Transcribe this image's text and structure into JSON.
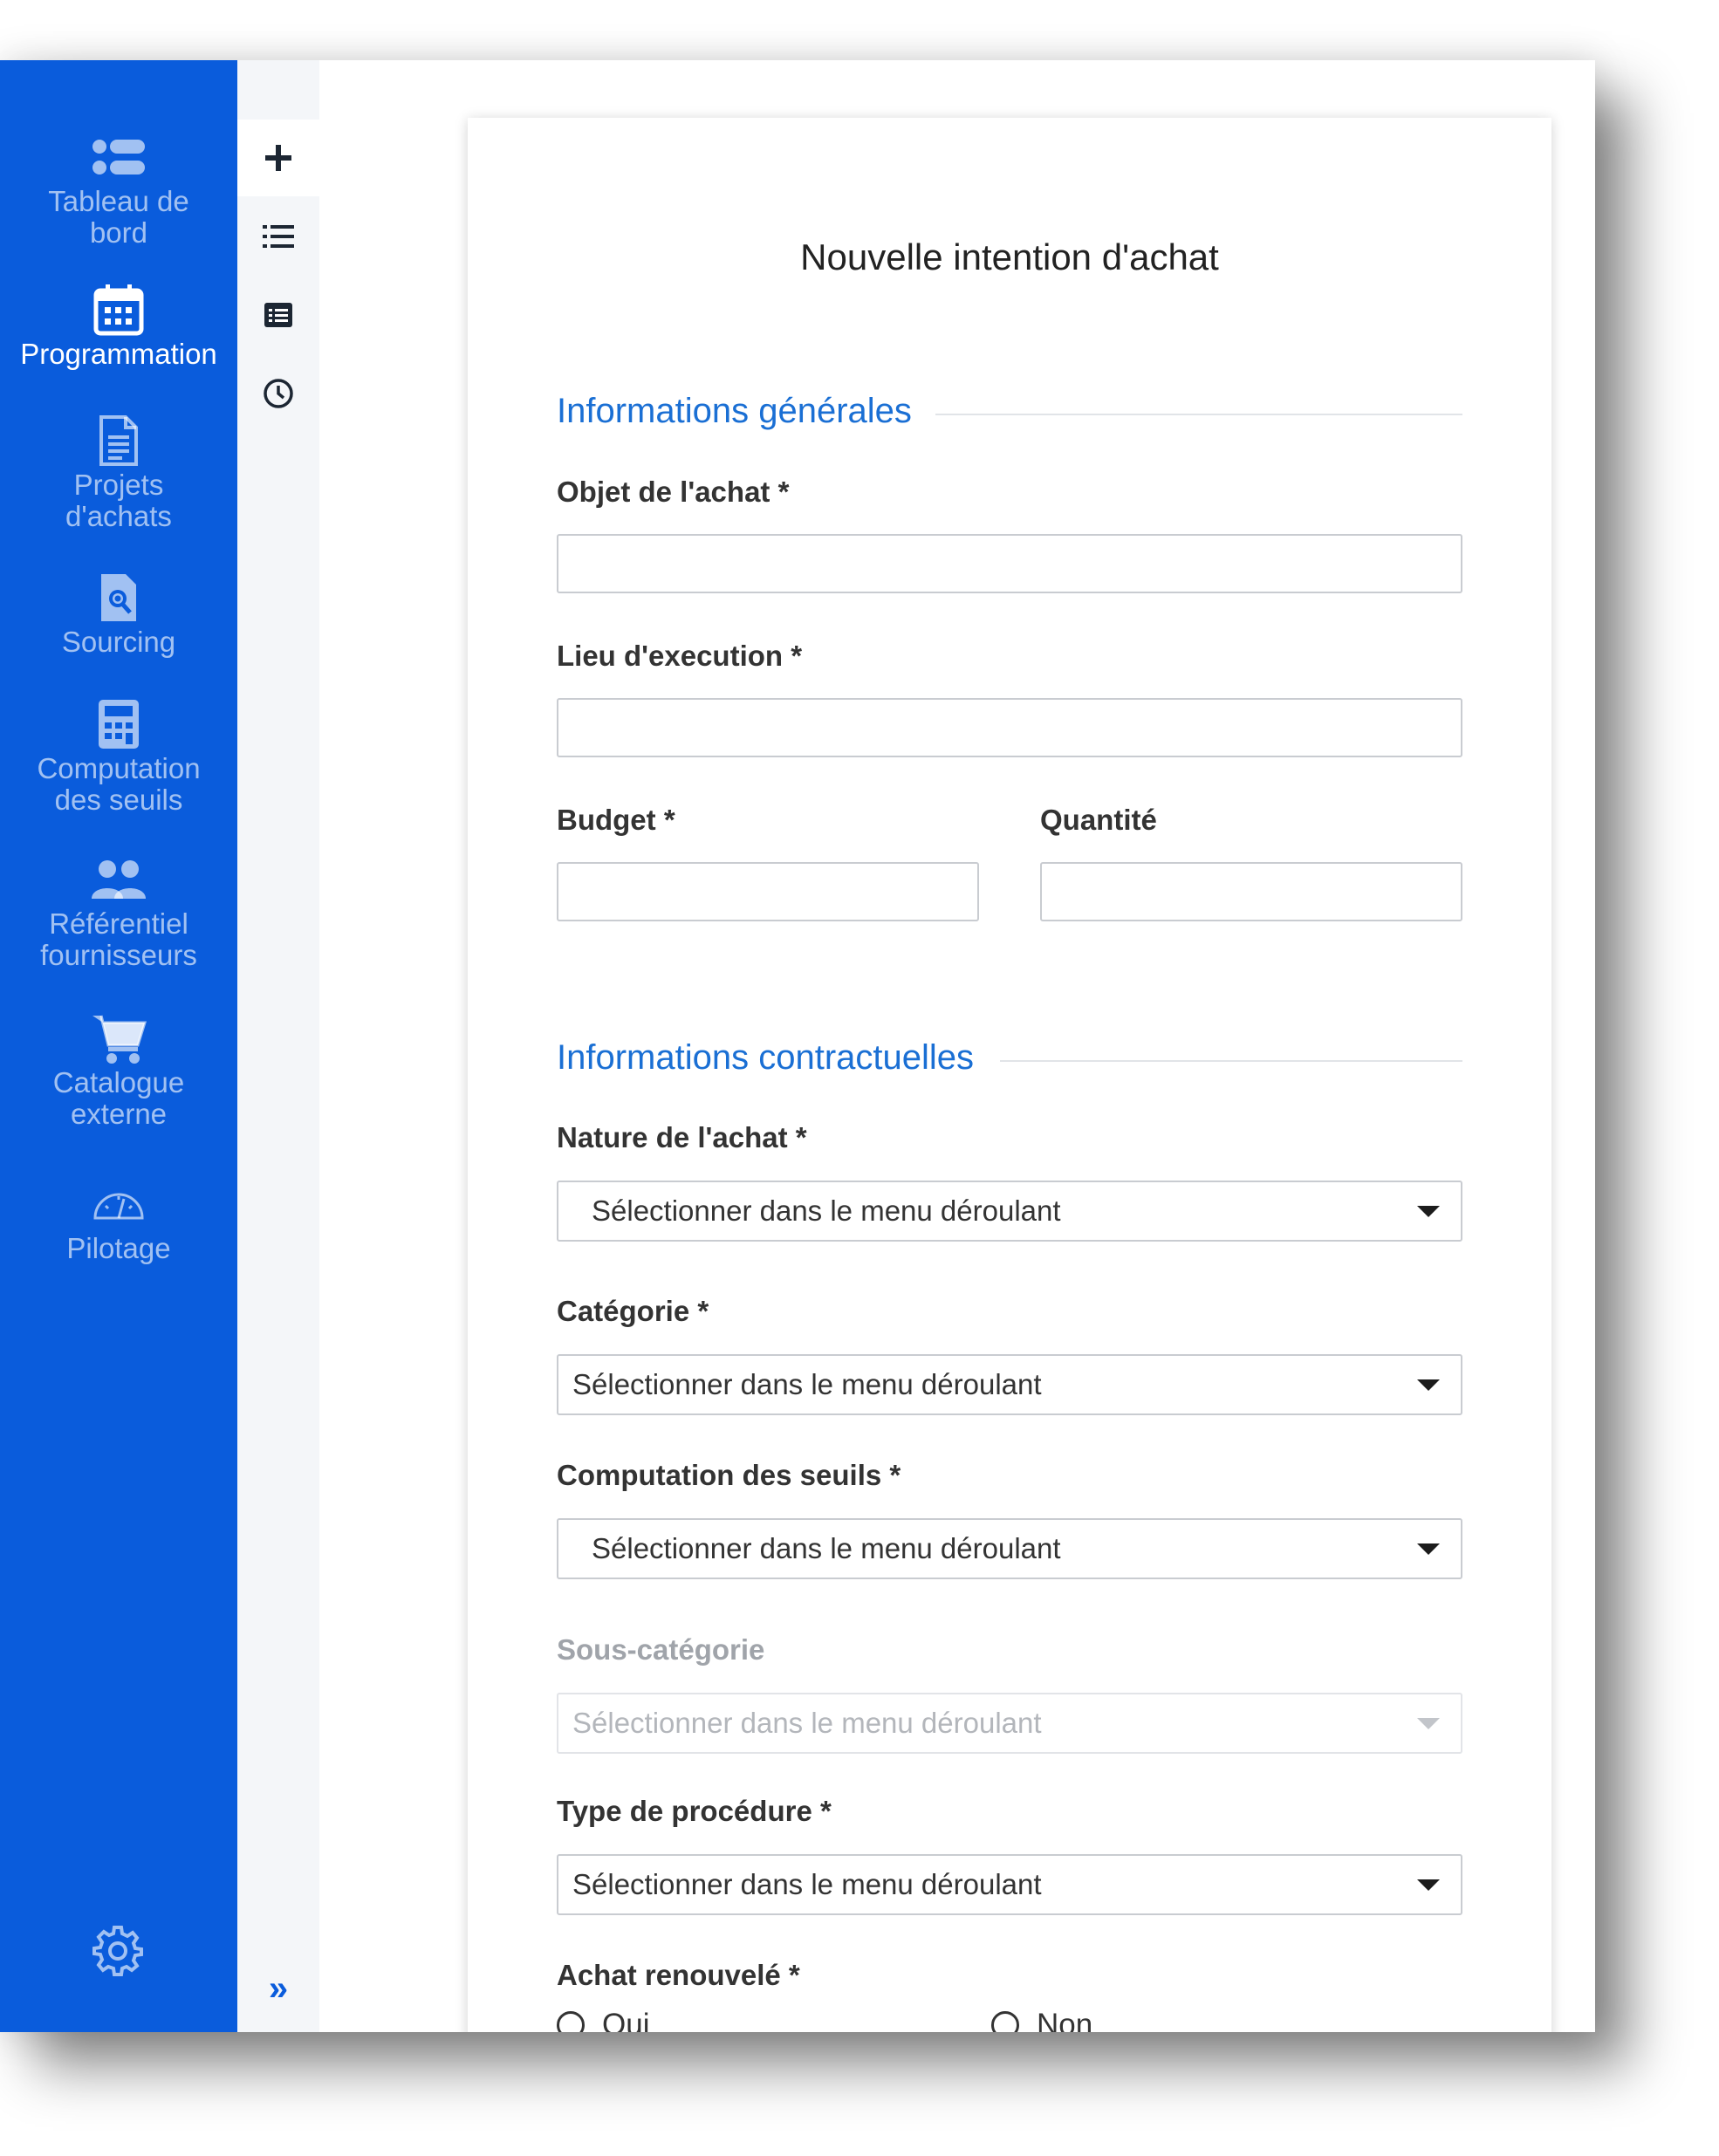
{
  "sidebar": {
    "items": [
      {
        "label": "Tableau de\nbord",
        "icon": "dashboard-icon"
      },
      {
        "label": "Programmation",
        "icon": "calendar-icon"
      },
      {
        "label": "Projets\nd'achats",
        "icon": "document-icon"
      },
      {
        "label": "Sourcing",
        "icon": "document-search-icon"
      },
      {
        "label": "Computation\ndes seuils",
        "icon": "calculator-icon"
      },
      {
        "label": "Référentiel\nfournisseurs",
        "icon": "users-icon"
      },
      {
        "label": "Catalogue\nexterne",
        "icon": "cart-icon"
      },
      {
        "label": "Pilotage",
        "icon": "gauge-icon"
      }
    ],
    "active_item": "Programmation",
    "settings_icon": "gear-icon"
  },
  "subrail": {
    "items": [
      {
        "icon": "plus-icon",
        "active": true
      },
      {
        "icon": "list-icon"
      },
      {
        "icon": "table-list-icon"
      },
      {
        "icon": "clock-icon"
      }
    ],
    "expand_label": "»"
  },
  "form": {
    "title": "Nouvelle intention d'achat",
    "section_general": "Informations générales",
    "objet_label": "Objet de l'achat *",
    "lieu_label": "Lieu d'execution *",
    "budget_label": "Budget *",
    "quantite_label": "Quantité",
    "section_contract": "Informations contractuelles",
    "nature_label": "Nature de l'achat *",
    "nature_placeholder": "Sélectionner dans le menu déroulant",
    "categorie_label": "Catégorie *",
    "categorie_placeholder": "Sélectionner dans le menu déroulant",
    "computation_label": "Computation des seuils *",
    "computation_placeholder": "Sélectionner dans le menu déroulant",
    "souscat_label": "Sous-catégorie",
    "souscat_placeholder": "Sélectionner dans le menu déroulant",
    "procedure_label": "Type de procédure *",
    "procedure_placeholder": "Sélectionner dans le menu déroulant",
    "renouvele_label": "Achat renouvelé *",
    "oui_label": "Oui",
    "non_label": "Non"
  },
  "colors": {
    "sidebar": "#0a5cdc",
    "section_title": "#1a6fd4",
    "text": "#333333"
  }
}
